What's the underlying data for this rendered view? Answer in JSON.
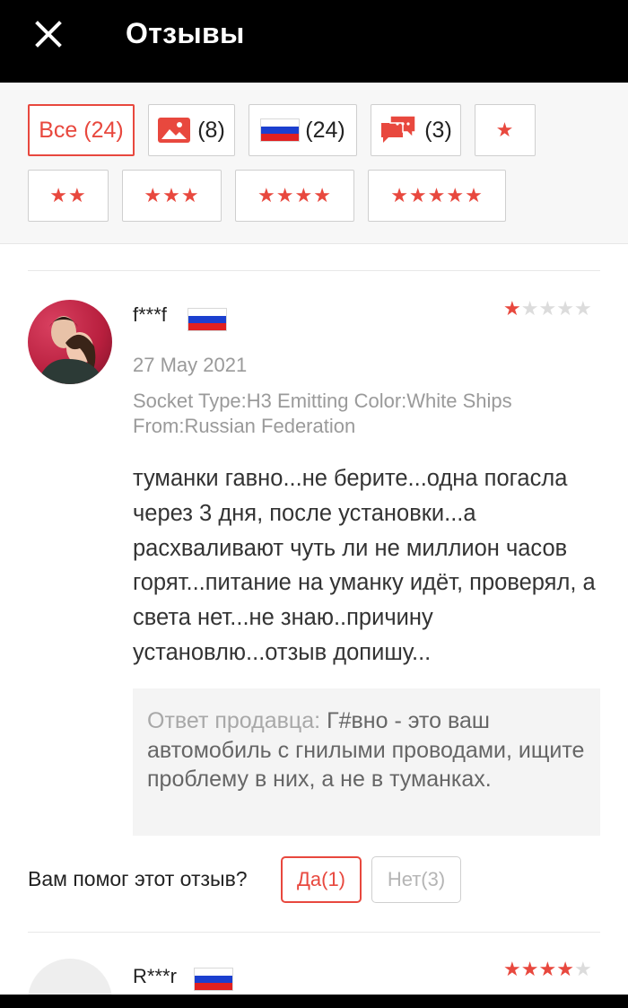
{
  "header": {
    "title": "Отзывы",
    "close_icon": "close-icon"
  },
  "filters": {
    "all_label": "Все (24)",
    "photos_count": "(8)",
    "russia_count": "(24)",
    "comments_count": "(3)",
    "star_filters": [
      "★",
      "★★",
      "★★★",
      "★★★★",
      "★★★★★"
    ]
  },
  "reviews": [
    {
      "user": "f***f",
      "country": "Russian Federation",
      "rating": 1,
      "date": "27 May 2021",
      "spec_line1": "Socket Type:H3 Emitting Color:White Ships",
      "spec_line2": "From:Russian Federation",
      "text": "туманки гавно...не берите...одна погасла через 3 дня, после установки...а расхваливают чуть ли не миллион часов горят...питание на уманку идёт, проверял, а света нет...не знаю..причину установлю...отзыв допишу...",
      "seller_label": "Ответ продавца: ",
      "seller_reply": "Г#вно - это ваш автомобиль с гнилыми проводами, ищите проблему в них, а не в туманках.",
      "helpful_question": "Вам помог этот отзыв?",
      "yes_label": "Да(1)",
      "no_label": "Нет(3)"
    },
    {
      "user": "R***r",
      "rating": 4
    }
  ],
  "colors": {
    "accent": "#e8483e",
    "header_bg": "#000000"
  }
}
